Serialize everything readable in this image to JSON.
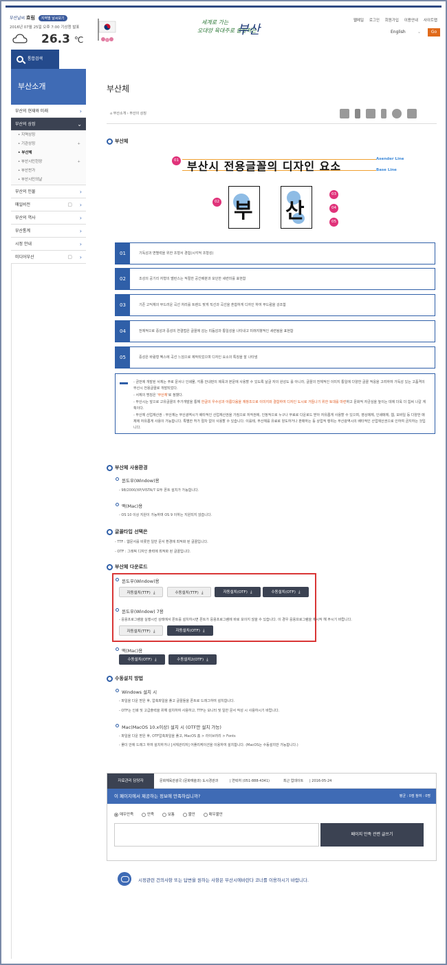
{
  "header": {
    "weather_label": "부산날씨",
    "weather_state": "흐림",
    "weather_badge": "지역별 날씨보기",
    "weather_date": "2016년 07월 25일 오후 7:00 기상청 발표",
    "temperature": "26.3",
    "temperature_unit": "℃",
    "logo_line1": "세계로 가는",
    "logo_line2": "오대양 육대주로 출발하는",
    "logo_city": "부산",
    "util_links": [
      "웹메일",
      "로그인",
      "회원가입",
      "이용안내",
      "사이트맵"
    ],
    "language_value": "English",
    "go_label": "Go"
  },
  "lnb": {
    "search_label": "통합검색",
    "title": "부산소개",
    "items": [
      {
        "label": "부산의 현재와 미래"
      },
      {
        "label": "부산의 상징"
      },
      {
        "label": "부산의 인물"
      },
      {
        "label": "매일비전"
      },
      {
        "label": "부산의 역사"
      },
      {
        "label": "부산통계"
      },
      {
        "label": "시정 안내"
      },
      {
        "label": "미디어부산"
      }
    ],
    "sub_items": [
      "• 지역상징",
      "• 기관상징",
      "• 부산체",
      "• 부산시민헌장",
      "• 부산찬가",
      "• 부산시민의날"
    ]
  },
  "page": {
    "title": "부산체",
    "breadcrumb": "부산소개 › 부산의 상징"
  },
  "sections": {
    "font": "부산체",
    "env": "부산체 사용환경",
    "type": "글꼴타입 선택은",
    "download": "부산체 다운로드",
    "manual": "수동설치 방법"
  },
  "diagram": {
    "title": "부산시 전용글꼴의 디자인 요소",
    "asender": "Asender Line",
    "base": "Base Line",
    "char1": "부",
    "char2": "산",
    "nums": [
      "01",
      "02",
      "03",
      "04",
      "05"
    ]
  },
  "features": [
    {
      "num": "01",
      "text": "기독성과 변별력을 위한 조형서 경험(시각적 조형성)"
    },
    {
      "num": "02",
      "text": "조성의 공기리 자형의 밸런스는 적절한 공간배분과 모던한 세련미를 표현함"
    },
    {
      "num": "03",
      "text": "기존 고딕체의 부드러운 곡선 처리를 트렌드 맞게 직선과 곡선을 혼합하게 디자인 하여 부드럼을 강조함"
    },
    {
      "num": "04",
      "text": "전체적으로 중성과 중성의 연결법은 글꼴에 감는 리듬감과 통일성을 나타내고 미래지향적인 세련됨을 표현함"
    },
    {
      "num": "05",
      "text": "중성은 바람형 벡스에 곡선 느낌으로 제작되었으며 디자인 요소의 특징을 잘 나타냄"
    }
  ],
  "notice": {
    "p1": "- 금번에 개발된 서체는 주로 문서나 인쇄물, 각종 안내판의 제목과 본문에 사용할 수 있도록 날글 자의 완성도 를 아니라, 글꼴의 전체적인 이미지 통일에 다양한 글꼴 적응을 고려하여 가독성 있는 고품격의 부산시 전용글꼴로 개발되었다.",
    "p2_pre": "- 서체의 명칭은 '",
    "p2_hl": "부산체",
    "p2_post": "'로 정했다.",
    "p3_pre": "- 부산시는 앞으로 고유글꼴의 추가개발을 통해 ",
    "p3_hl": "한글의 우수성과 아름다움을 재창조으로 이미지와 결합하여 디자인 도시로 거듭나기 위한 토대를 마련",
    "p3_post": "하고 문화적 자긍심을 높이는 데에 더욱 더 힘써 나갈 계획이다.",
    "p4": "- 부산체 산업재산권 : 부산체는 부산광역시가 배타적인 산업재산권을 가짐으로 저작권에, 인정적으로 누구나 무료로 다운로드 받아 자유롭게 사용할 수 있으며, 영상매체, 인쇄매체, 웹, 모바일 등 다양한 매체에 자유롭게 사용이 가능합니다. 특별한 허가 절차 없이 사용할 수 있습니다. 이를테, 부산체를 유료로 양도하거나 판매하는 등 상업적 행위는 부산광역시의 배타적인 산업재산권으로 인하여 금지하는 것입니다."
  },
  "env": {
    "win_title": "윈도우(Window)용",
    "win_desc": "- 98/2000/XP/VISTA/7 모두 폰트 설치가 가능합니다.",
    "mac_title": "맥(Mac)용",
    "mac_desc": "- OS 10 이상 지원이 가능하며 OS 9 이하는 지원되지 않습니다."
  },
  "fonttype": {
    "ttf": "- TTF : 웹문서를 비롯한 일반 문서 환경에 최적화 된 글꼴입니다.",
    "otf": "- OTF : 그래픽 디자인 출력에 최적화 된 글꼴입니다."
  },
  "download": {
    "win_title": "윈도우(Window)용",
    "win_buttons": [
      "자동설치(TTF)",
      "수동설치(TTF)",
      "자동설치(OTF)",
      "수동설치(OTF)"
    ],
    "win7_title": "윈도우(Window) 7용",
    "win7_desc": "- 응용프로그램을 실행시킨 상태에서 폰트를 설치하시면 폰트가 응용프로그램에 바로 보이지 않을 수 있습니다. 이 경우 응용프로그램을 재시작 해 주시기 바랍니다.",
    "win7_buttons": [
      "자동설치(TTF)",
      "자동설치(OTF)"
    ],
    "mac_title": "맥(Mac)용",
    "mac_buttons": [
      "수동설치(OTF)",
      "수동설치2(OTF)"
    ],
    "dl_glyph": "⤓"
  },
  "manual": {
    "win_title": "Windows 설치 시",
    "win_d1": "- 파일을 다운 받은 후, 압축파일을 풀고 글꼴들을 폰트로 드래그하여 설치합니다.",
    "win_d2": "- OTF는 인쇄 및 고급출력을 위해 설치하여 사용하고, TTF는 모니터 및 일반 문서 작성 시 사용하시기 바랍니다.",
    "mac_title": "Mac(MacOS 10.x이상) 설치 시 (OTF만 설치 가능)",
    "mac_d1": "- 파일을 다운 받은 후, OTF압축파일을 풀고, MacOS 홈 > 라이브러리 > Fonts",
    "mac_d2": "- 폴더 안에 드래그 하여 설치하거나 [서체관리자] 어플리케이션을 이용하여 설치합니다. (MacOS는 수동설치만 가능합니다.)"
  },
  "satisfaction": {
    "dept_label": "자료관리 담당자",
    "dept": "문화체육관광국 (문화예술과) 도시경관과",
    "phone": "| 연락처 (051-888-4341)",
    "updated_label": "최근 업데이트",
    "updated": "| 2016-05-24",
    "question": "이 페이지에서 제공하는 정보에 만족하십니까?",
    "score": "평균 : 0점  참여 : 0명",
    "options": [
      "매우만족",
      "만족",
      "보통",
      "불만",
      "매우불만"
    ],
    "submit": "페이지 만족 관련 글쓰기"
  },
  "footnote": "시정관련 건의사항 또는 답변을 원하는 사항은 부산시에바란다 코너를 이용하시기 바랍니다."
}
